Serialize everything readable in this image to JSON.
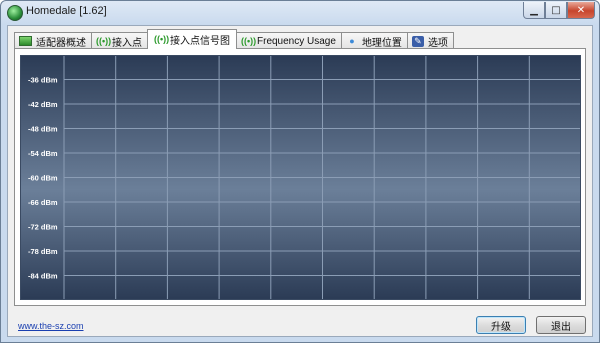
{
  "window": {
    "title": "Homedale [1.62]",
    "minimize_glyph": "▁",
    "maximize_glyph": "□",
    "close_glyph": "✕"
  },
  "tabs": [
    {
      "label": "适配器概述",
      "icon": "network-adapter-icon",
      "active": false
    },
    {
      "label": "接入点",
      "icon": "wifi-signal-icon",
      "active": false
    },
    {
      "label": "接入点信号图",
      "icon": "wifi-signal-icon",
      "active": true
    },
    {
      "label": "Frequency Usage",
      "icon": "wifi-signal-icon",
      "active": false
    },
    {
      "label": "地理位置",
      "icon": "location-pin-icon",
      "active": false
    },
    {
      "label": "选项",
      "icon": "options-icon",
      "active": false
    }
  ],
  "chart_data": {
    "type": "line",
    "title": "",
    "xlabel": "",
    "ylabel": "",
    "y_tick_labels": [
      "-36 dBm",
      "-42 dBm",
      "-48 dBm",
      "-54 dBm",
      "-60 dBm",
      "-66 dBm",
      "-72 dBm",
      "-78 dBm",
      "-84 dBm"
    ],
    "y_ticks": [
      -36,
      -42,
      -48,
      -54,
      -60,
      -66,
      -72,
      -78,
      -84
    ],
    "ylim": [
      -90,
      -30
    ],
    "vertical_grid_count": 10,
    "grid": true,
    "series": [],
    "background_colors": [
      "#2b3b55",
      "#6b7f99",
      "#2b3b55"
    ],
    "grid_color": "#8b9db5",
    "label_color": "#ffffff"
  },
  "footer": {
    "link_text": "www.the-sz.com",
    "upgrade_label": "升级",
    "exit_label": "退出"
  }
}
